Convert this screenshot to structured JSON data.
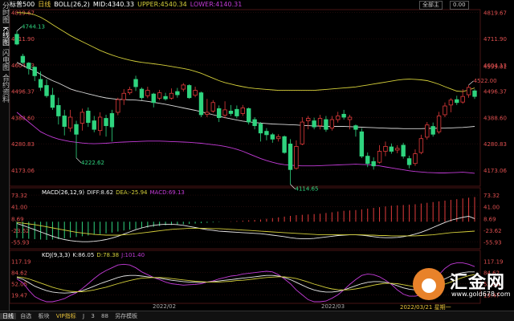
{
  "top_bar": {
    "symbol": "标普500",
    "period": "日线",
    "boll_params": "BOLL(26,2)",
    "mid": "MID:4340.33",
    "upper": "UPPER:4540.34",
    "lower": "LOWER:4140.31",
    "buttons": [
      "全部主",
      "0.00"
    ]
  },
  "sidebar_tabs": [
    "分时图",
    "K线图",
    "闪电图",
    "合约资料"
  ],
  "colors": {
    "up": "#e23b3b",
    "down": "#2fd47f",
    "mid": "#d8d8d8",
    "upper": "#d4cf3a",
    "lower": "#c43bd8",
    "axis_text": "#e05050",
    "dif": "#e8e8e8",
    "dea": "#d4cf3a",
    "k": "#e8e8e8",
    "d": "#d4cf3a",
    "j": "#c43bd8"
  },
  "macd_label": {
    "title": "MACD(26,12,9)",
    "dif": "DIFF:8.62",
    "dea": "DEA:-25.94",
    "macd": "MACD:69.13"
  },
  "kdj_label": {
    "title": "KDJ(9,3,3)",
    "k": "K:86.05",
    "d": "D:78.38",
    "j": "J:101.40"
  },
  "bottom_bar": [
    "日线",
    "自选",
    "板块",
    "VIP指标",
    "J",
    "3",
    "88",
    "另存模板"
  ],
  "date_labels": [
    "2022/02",
    "2022/03",
    "2022/03/21 星期一"
  ],
  "logo": {
    "name": "汇金网",
    "url": "www.gold678.com"
  },
  "chart_data": [
    {
      "type": "candlestick",
      "title": "标普500 日线 BOLL(26,2)",
      "ylim": [
        4120.0,
        4819.67
      ],
      "yticks": [
        4819.67,
        4711.9,
        4604.13,
        4496.37,
        4388.6,
        4280.83,
        4173.06
      ],
      "yticks_right_extra": [
        "4599.01"
      ],
      "annotations": [
        {
          "label": "4744.13",
          "index": 0,
          "value": 4744.13
        },
        {
          "label": "4222.62",
          "index": 10,
          "value": 4222.62
        },
        {
          "label": "4114.65",
          "index": 46,
          "value": 4114.65
        },
        {
          "label": "4522.00",
          "index": 76,
          "value": 4522.0
        }
      ],
      "candles": [
        {
          "o": 4730,
          "c": 4690,
          "h": 4744.13,
          "l": 4685
        },
        {
          "o": 4640,
          "c": 4614,
          "h": 4650,
          "l": 4608
        },
        {
          "o": 4612,
          "c": 4590,
          "h": 4616,
          "l": 4565
        },
        {
          "o": 4595,
          "c": 4560,
          "h": 4598,
          "l": 4538
        },
        {
          "o": 4545,
          "c": 4512,
          "h": 4578,
          "l": 4498
        },
        {
          "o": 4520,
          "c": 4478,
          "h": 4545,
          "l": 4470
        },
        {
          "o": 4480,
          "c": 4430,
          "h": 4510,
          "l": 4420
        },
        {
          "o": 4438,
          "c": 4395,
          "h": 4470,
          "l": 4360
        },
        {
          "o": 4395,
          "c": 4352,
          "h": 4420,
          "l": 4315
        },
        {
          "o": 4345,
          "c": 4390,
          "h": 4420,
          "l": 4330
        },
        {
          "o": 4360,
          "c": 4320,
          "h": 4375,
          "l": 4222.62
        },
        {
          "o": 4365,
          "c": 4410,
          "h": 4425,
          "l": 4335
        },
        {
          "o": 4415,
          "c": 4368,
          "h": 4430,
          "l": 4350
        },
        {
          "o": 4375,
          "c": 4340,
          "h": 4395,
          "l": 4328
        },
        {
          "o": 4335,
          "c": 4390,
          "h": 4410,
          "l": 4315
        },
        {
          "o": 4385,
          "c": 4355,
          "h": 4400,
          "l": 4310
        },
        {
          "o": 4405,
          "c": 4350,
          "h": 4420,
          "l": 4290
        },
        {
          "o": 4410,
          "c": 4462,
          "h": 4470,
          "l": 4398
        },
        {
          "o": 4462,
          "c": 4488,
          "h": 4505,
          "l": 4440
        },
        {
          "o": 4490,
          "c": 4504,
          "h": 4515,
          "l": 4482
        },
        {
          "o": 4545,
          "c": 4515,
          "h": 4560,
          "l": 4498
        },
        {
          "o": 4505,
          "c": 4470,
          "h": 4512,
          "l": 4460
        },
        {
          "o": 4478,
          "c": 4500,
          "h": 4515,
          "l": 4468
        },
        {
          "o": 4485,
          "c": 4450,
          "h": 4490,
          "l": 4430
        },
        {
          "o": 4468,
          "c": 4490,
          "h": 4502,
          "l": 4460
        },
        {
          "o": 4475,
          "c": 4465,
          "h": 4490,
          "l": 4458
        },
        {
          "o": 4468,
          "c": 4488,
          "h": 4508,
          "l": 4462
        },
        {
          "o": 4495,
          "c": 4482,
          "h": 4510,
          "l": 4470
        },
        {
          "o": 4505,
          "c": 4522,
          "h": 4530,
          "l": 4495
        },
        {
          "o": 4520,
          "c": 4470,
          "h": 4525,
          "l": 4465
        },
        {
          "o": 4480,
          "c": 4500,
          "h": 4515,
          "l": 4472
        },
        {
          "o": 4490,
          "c": 4400,
          "h": 4495,
          "l": 4390
        },
        {
          "o": 4402,
          "c": 4410,
          "h": 4465,
          "l": 4390
        },
        {
          "o": 4415,
          "c": 4450,
          "h": 4460,
          "l": 4408
        },
        {
          "o": 4425,
          "c": 4388,
          "h": 4438,
          "l": 4370
        },
        {
          "o": 4398,
          "c": 4420,
          "h": 4455,
          "l": 4385
        },
        {
          "o": 4415,
          "c": 4405,
          "h": 4440,
          "l": 4395
        },
        {
          "o": 4422,
          "c": 4395,
          "h": 4438,
          "l": 4385
        },
        {
          "o": 4405,
          "c": 4428,
          "h": 4440,
          "l": 4395
        },
        {
          "o": 4425,
          "c": 4370,
          "h": 4430,
          "l": 4360
        },
        {
          "o": 4380,
          "c": 4355,
          "h": 4390,
          "l": 4340
        },
        {
          "o": 4362,
          "c": 4325,
          "h": 4370,
          "l": 4290
        },
        {
          "o": 4332,
          "c": 4318,
          "h": 4345,
          "l": 4295
        },
        {
          "o": 4318,
          "c": 4300,
          "h": 4325,
          "l": 4285
        },
        {
          "o": 4302,
          "c": 4310,
          "h": 4320,
          "l": 4290
        },
        {
          "o": 4310,
          "c": 4245,
          "h": 4315,
          "l": 4240
        },
        {
          "o": 4280,
          "c": 4175,
          "h": 4300,
          "l": 4114.65
        },
        {
          "o": 4180,
          "c": 4270,
          "h": 4295,
          "l": 4175
        },
        {
          "o": 4280,
          "c": 4370,
          "h": 4390,
          "l": 4275
        },
        {
          "o": 4375,
          "c": 4385,
          "h": 4395,
          "l": 4340
        },
        {
          "o": 4375,
          "c": 4350,
          "h": 4388,
          "l": 4340
        },
        {
          "o": 4355,
          "c": 4385,
          "h": 4400,
          "l": 4340
        },
        {
          "o": 4380,
          "c": 4340,
          "h": 4395,
          "l": 4330
        },
        {
          "o": 4345,
          "c": 4380,
          "h": 4395,
          "l": 4335
        },
        {
          "o": 4380,
          "c": 4395,
          "h": 4412,
          "l": 4368
        },
        {
          "o": 4402,
          "c": 4390,
          "h": 4420,
          "l": 4380
        },
        {
          "o": 4380,
          "c": 4390,
          "h": 4400,
          "l": 4340
        },
        {
          "o": 4355,
          "c": 4340,
          "h": 4360,
          "l": 4310
        },
        {
          "o": 4330,
          "c": 4230,
          "h": 4345,
          "l": 4222
        },
        {
          "o": 4230,
          "c": 4200,
          "h": 4245,
          "l": 4185
        },
        {
          "o": 4208,
          "c": 4190,
          "h": 4225,
          "l": 4175
        },
        {
          "o": 4205,
          "c": 4250,
          "h": 4275,
          "l": 4200
        },
        {
          "o": 4250,
          "c": 4270,
          "h": 4290,
          "l": 4230
        },
        {
          "o": 4268,
          "c": 4250,
          "h": 4282,
          "l": 4240
        },
        {
          "o": 4255,
          "c": 4262,
          "h": 4275,
          "l": 4242
        },
        {
          "o": 4275,
          "c": 4230,
          "h": 4285,
          "l": 4220
        },
        {
          "o": 4220,
          "c": 4195,
          "h": 4232,
          "l": 4180
        },
        {
          "o": 4200,
          "c": 4240,
          "h": 4258,
          "l": 4190
        },
        {
          "o": 4245,
          "c": 4302,
          "h": 4318,
          "l": 4238
        },
        {
          "o": 4308,
          "c": 4358,
          "h": 4370,
          "l": 4298
        },
        {
          "o": 4352,
          "c": 4320,
          "h": 4368,
          "l": 4310
        },
        {
          "o": 4330,
          "c": 4395,
          "h": 4412,
          "l": 4322
        },
        {
          "o": 4400,
          "c": 4436,
          "h": 4450,
          "l": 4390
        },
        {
          "o": 4440,
          "c": 4460,
          "h": 4468,
          "l": 4410
        },
        {
          "o": 4462,
          "c": 4450,
          "h": 4478,
          "l": 4440
        },
        {
          "o": 4452,
          "c": 4475,
          "h": 4505,
          "l": 4445
        },
        {
          "o": 4482,
          "c": 4512,
          "h": 4522.0,
          "l": 4470
        },
        {
          "o": 4498,
          "c": 4475,
          "h": 4505,
          "l": 4465
        }
      ],
      "boll_mid": [
        4615,
        4602,
        4590,
        4580,
        4566,
        4552,
        4540,
        4530,
        4518,
        4506,
        4498,
        4492,
        4486,
        4480,
        4474,
        4469,
        4466,
        4463,
        4462,
        4461,
        4460,
        4458,
        4455,
        4451,
        4447,
        4443,
        4438,
        4433,
        4428,
        4423,
        4418,
        4412,
        4406,
        4400,
        4394,
        4388,
        4383,
        4378,
        4374,
        4371,
        4368,
        4366,
        4364,
        4362,
        4361,
        4360,
        4359,
        4358,
        4356,
        4355,
        4354,
        4353,
        4352,
        4352,
        4352,
        4352,
        4351,
        4350,
        4349,
        4348,
        4347,
        4346,
        4345,
        4344,
        4344,
        4343,
        4343,
        4343,
        4343,
        4344,
        4344,
        4345,
        4345,
        4346,
        4347,
        4348,
        4350,
        4352
      ],
      "boll_upper": [
        4819,
        4818,
        4816,
        4810,
        4800,
        4786,
        4770,
        4755,
        4740,
        4725,
        4712,
        4700,
        4688,
        4676,
        4664,
        4654,
        4645,
        4637,
        4630,
        4624,
        4619,
        4615,
        4612,
        4609,
        4606,
        4602,
        4598,
        4594,
        4590,
        4585,
        4578,
        4570,
        4560,
        4550,
        4540,
        4532,
        4526,
        4520,
        4515,
        4511,
        4508,
        4506,
        4504,
        4502,
        4500,
        4500,
        4500,
        4500,
        4500,
        4500,
        4500,
        4502,
        4504,
        4506,
        4508,
        4510,
        4512,
        4514,
        4518,
        4522,
        4526,
        4530,
        4534,
        4538,
        4542,
        4545,
        4546,
        4545,
        4543,
        4540,
        4533,
        4525,
        4515,
        4506,
        4497,
        4495,
        4502,
        4510
      ],
      "boll_lower": [
        4410,
        4390,
        4370,
        4350,
        4330,
        4318,
        4308,
        4300,
        4295,
        4290,
        4287,
        4284,
        4282,
        4281,
        4282,
        4283,
        4285,
        4287,
        4288,
        4289,
        4290,
        4291,
        4292,
        4292,
        4292,
        4291,
        4290,
        4289,
        4288,
        4287,
        4285,
        4283,
        4280,
        4277,
        4274,
        4270,
        4265,
        4258,
        4250,
        4240,
        4230,
        4220,
        4212,
        4205,
        4199,
        4195,
        4193,
        4191,
        4190,
        4190,
        4190,
        4191,
        4192,
        4193,
        4194,
        4195,
        4196,
        4197,
        4196,
        4195,
        4193,
        4190,
        4186,
        4182,
        4178,
        4174,
        4170,
        4167,
        4165,
        4163,
        4162,
        4161,
        4161,
        4162,
        4163,
        4164,
        4162,
        4160
      ]
    },
    {
      "type": "bar+line",
      "title": "MACD(26,12,9)",
      "ylim": [
        -70,
        80
      ],
      "yticks": [
        73.32,
        41.0,
        8.69,
        -23.62,
        -55.93
      ],
      "histogram": [
        -45,
        -46,
        -47,
        -48,
        -49,
        -50,
        -49,
        -48,
        -46,
        -44,
        -42,
        -40,
        -38,
        -36,
        -34,
        -32,
        -30,
        -27,
        -24,
        -22,
        -20,
        -18,
        -16,
        -14,
        -12,
        -10,
        -9,
        -8,
        -7,
        -6,
        -5,
        -4,
        -3,
        -2,
        -1,
        0,
        1,
        2,
        3,
        4,
        5,
        6,
        8,
        10,
        12,
        14,
        16,
        18,
        19,
        20,
        21,
        22,
        24,
        26,
        28,
        30,
        31,
        32,
        34,
        36,
        38,
        40,
        42,
        44,
        45,
        46,
        47,
        48,
        50,
        52,
        54,
        56,
        58,
        60,
        62,
        64,
        66,
        68
      ],
      "dif": [
        -5,
        -10,
        -16,
        -22,
        -28,
        -34,
        -40,
        -45,
        -49,
        -52,
        -54,
        -55,
        -55,
        -54,
        -52,
        -49,
        -45,
        -40,
        -34,
        -28,
        -22,
        -17,
        -13,
        -10,
        -8,
        -7,
        -7,
        -8,
        -10,
        -13,
        -16,
        -19,
        -22,
        -24,
        -26,
        -27,
        -28,
        -29,
        -30,
        -31,
        -32,
        -33,
        -35,
        -37,
        -39,
        -41,
        -44,
        -46,
        -47,
        -47,
        -46,
        -44,
        -42,
        -40,
        -38,
        -37,
        -36,
        -36,
        -37,
        -39,
        -41,
        -43,
        -44,
        -44,
        -43,
        -41,
        -38,
        -34,
        -29,
        -23,
        -16,
        -9,
        -2,
        4,
        8,
        12,
        15,
        8.62
      ],
      "dea": [
        -2,
        -4,
        -6,
        -8,
        -11,
        -14,
        -17,
        -20,
        -23,
        -26,
        -29,
        -31,
        -33,
        -35,
        -36,
        -37,
        -37,
        -37,
        -36,
        -35,
        -33,
        -31,
        -29,
        -27,
        -25,
        -23,
        -21,
        -20,
        -19,
        -18,
        -18,
        -18,
        -18,
        -19,
        -19,
        -20,
        -21,
        -22,
        -23,
        -24,
        -25,
        -26,
        -27,
        -28,
        -29,
        -30,
        -31,
        -32,
        -33,
        -34,
        -35,
        -36,
        -36,
        -36,
        -36,
        -36,
        -36,
        -36,
        -36,
        -37,
        -37,
        -38,
        -38,
        -39,
        -39,
        -39,
        -39,
        -39,
        -38,
        -37,
        -36,
        -34,
        -32,
        -30,
        -29,
        -28,
        -27,
        -25.94
      ]
    },
    {
      "type": "line",
      "title": "KDJ(9,3,3)",
      "ylim": [
        0,
        125
      ],
      "yticks": [
        117.19,
        84.62,
        52.05,
        19.47
      ],
      "k": [
        70,
        65,
        55,
        45,
        38,
        32,
        28,
        26,
        25,
        26,
        28,
        32,
        38,
        45,
        52,
        58,
        64,
        70,
        74,
        76,
        76,
        74,
        72,
        70,
        68,
        65,
        62,
        60,
        58,
        57,
        56,
        56,
        57,
        58,
        60,
        62,
        64,
        66,
        68,
        70,
        72,
        74,
        76,
        76,
        74,
        70,
        64,
        56,
        48,
        40,
        34,
        30,
        28,
        28,
        30,
        34,
        40,
        46,
        52,
        56,
        58,
        58,
        56,
        52,
        46,
        40,
        36,
        34,
        34,
        38,
        46,
        56,
        66,
        74,
        80,
        84,
        86,
        86.05
      ],
      "d": [
        72,
        70,
        66,
        60,
        54,
        48,
        42,
        37,
        33,
        30,
        29,
        29,
        31,
        34,
        38,
        42,
        47,
        52,
        57,
        61,
        65,
        68,
        69,
        70,
        70,
        69,
        67,
        65,
        63,
        61,
        59,
        58,
        57,
        57,
        57,
        58,
        59,
        61,
        62,
        64,
        66,
        68,
        70,
        71,
        72,
        72,
        70,
        67,
        62,
        57,
        51,
        46,
        41,
        37,
        35,
        34,
        35,
        37,
        40,
        44,
        48,
        51,
        53,
        53,
        52,
        49,
        46,
        43,
        41,
        40,
        41,
        45,
        51,
        57,
        64,
        70,
        75,
        78.38
      ],
      "j": [
        66,
        55,
        33,
        15,
        6,
        0,
        0,
        4,
        9,
        18,
        26,
        38,
        52,
        67,
        80,
        90,
        98,
        106,
        108,
        106,
        98,
        86,
        78,
        70,
        64,
        57,
        52,
        50,
        48,
        49,
        50,
        52,
        57,
        60,
        66,
        70,
        74,
        76,
        80,
        82,
        84,
        86,
        88,
        86,
        78,
        66,
        52,
        34,
        20,
        6,
        0,
        0,
        2,
        10,
        20,
        34,
        50,
        64,
        76,
        80,
        78,
        72,
        62,
        50,
        34,
        22,
        16,
        16,
        20,
        34,
        56,
        78,
        96,
        108,
        112,
        112,
        108,
        101.4
      ]
    }
  ]
}
